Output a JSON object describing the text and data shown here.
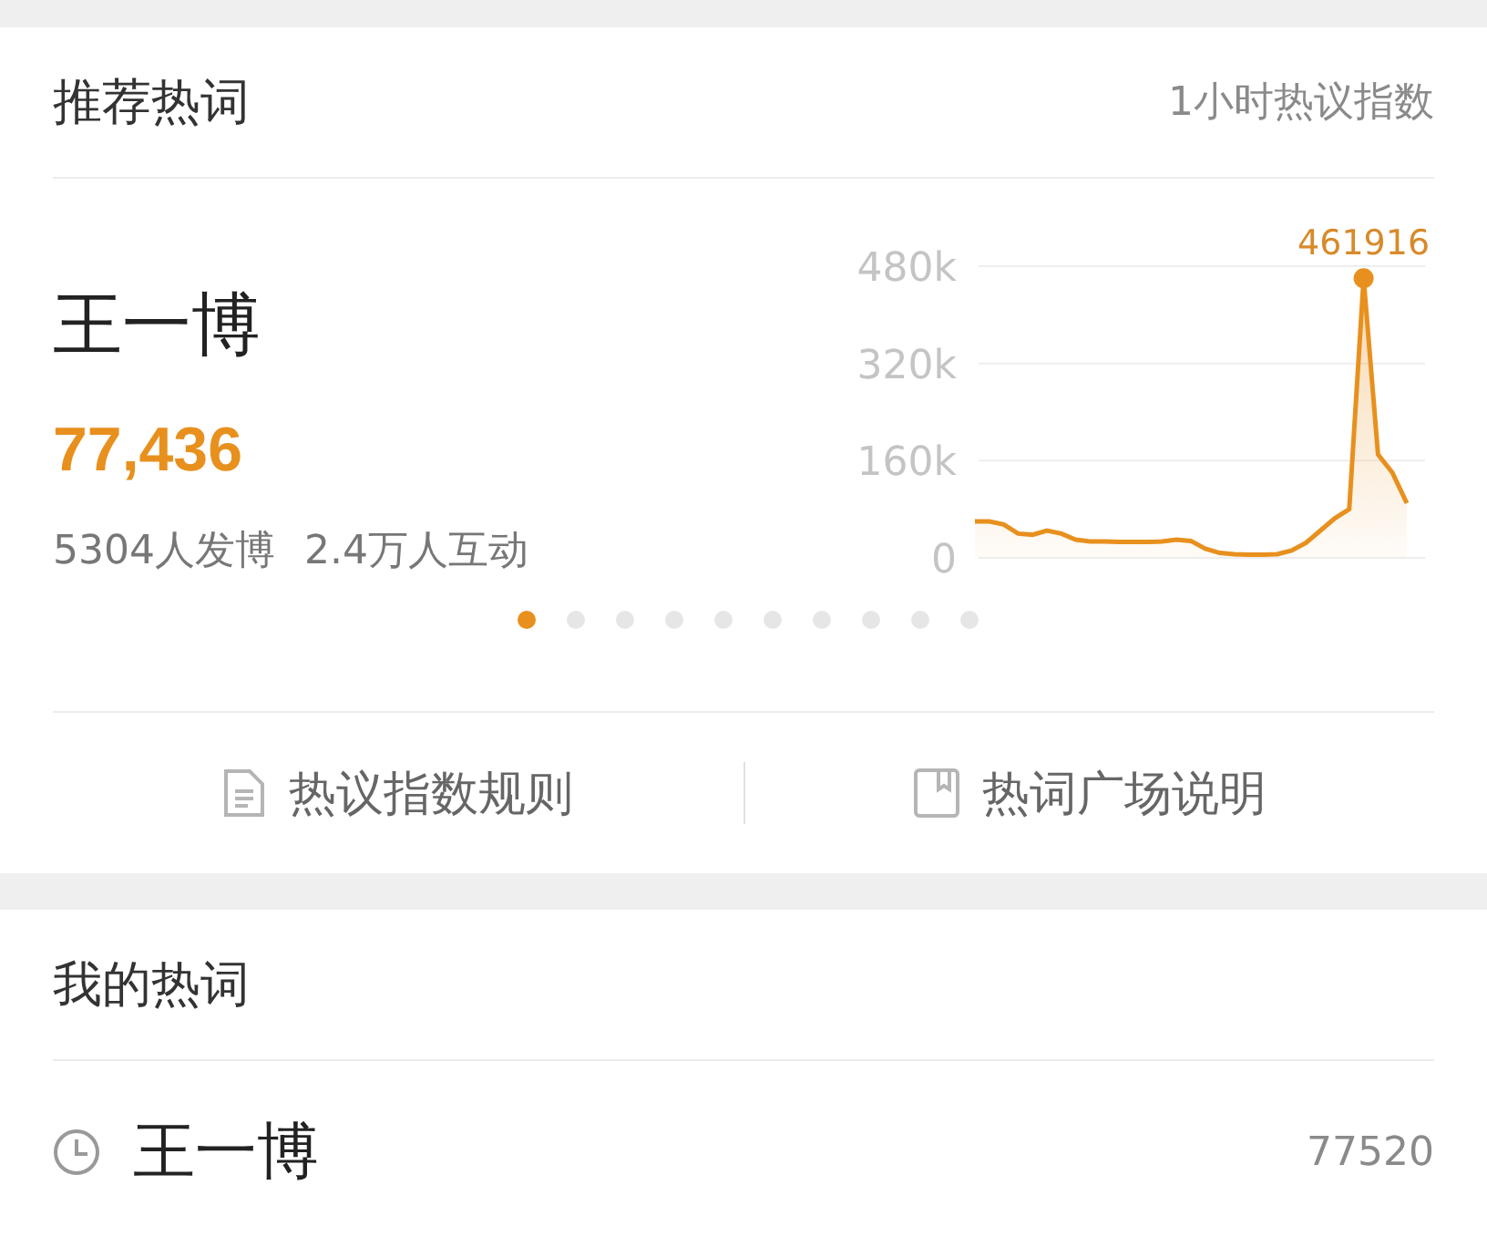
{
  "recommended": {
    "title": "推荐热词",
    "subtitle": "1小时热议指数",
    "topic": {
      "name": "王一博",
      "index": "77,436",
      "posts": "5304人发博",
      "interactions": "2.4万人互动",
      "chart_data": {
        "type": "area",
        "yticks": [
          {
            "value": 0,
            "label": "0"
          },
          {
            "value": 160000,
            "label": "160k"
          },
          {
            "value": 320000,
            "label": "320k"
          },
          {
            "value": 480000,
            "label": "480k"
          }
        ],
        "ylim": [
          0,
          480000
        ],
        "series": [
          {
            "color": "#e8901e",
            "values": [
              60000,
              60000,
              55000,
              40000,
              38000,
              45000,
              40000,
              30000,
              27000,
              27000,
              26000,
              26000,
              26000,
              27000,
              30000,
              28000,
              15000,
              8000,
              6000,
              5000,
              5000,
              6000,
              12000,
              25000,
              45000,
              65000,
              80000,
              460000,
              170000,
              140000,
              90000
            ]
          }
        ],
        "annotations": [
          {
            "y": 460000,
            "text": "461916"
          }
        ]
      }
    },
    "pages": [
      {
        "selected": true
      },
      {
        "selected": false
      },
      {
        "selected": false
      },
      {
        "selected": false
      },
      {
        "selected": false
      },
      {
        "selected": false
      },
      {
        "selected": false
      },
      {
        "selected": false
      },
      {
        "selected": false
      },
      {
        "selected": false
      }
    ],
    "links": [
      {
        "kind": "document",
        "label": "热议指数规则"
      },
      {
        "kind": "bookmark",
        "label": "热词广场说明"
      }
    ]
  },
  "mine": {
    "title": "我的热词",
    "items": [
      {
        "name": "王一博",
        "index": "77520"
      }
    ]
  }
}
